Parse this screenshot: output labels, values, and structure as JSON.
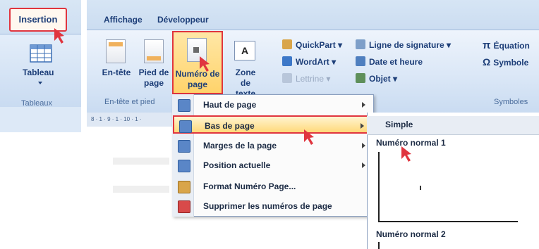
{
  "left_ribbon": {
    "tab_insertion": "Insertion",
    "table_button": "Tableau",
    "group_label": "Tableaux"
  },
  "tabs": {
    "affichage": "Affichage",
    "developpeur": "Développeur"
  },
  "ribbon": {
    "entete": "En-tête",
    "pied_de_page": "Pied de page",
    "numero_de_page": "Numéro de page",
    "zone_de_texte": "Zone de texte",
    "quickpart": "QuickPart",
    "wordart": "WordArt",
    "lettrine": "Lettrine",
    "ligne_signature": "Ligne de signature",
    "date_heure": "Date et heure",
    "objet": "Objet",
    "equation": "Équation",
    "symbole": "Symbole",
    "group_entete": "En-tête et pied",
    "group_symboles": "Symboles"
  },
  "ruler_text": "8 · 1 · 9 · 1 · 10 · 1 ·",
  "menu": {
    "items": [
      {
        "label": "Haut de page"
      },
      {
        "label": "Bas de page"
      },
      {
        "label": "Marges de la page"
      },
      {
        "label": "Position actuelle"
      },
      {
        "label": "Format Numéro Page..."
      },
      {
        "label": "Supprimer les numéros de page"
      }
    ]
  },
  "gallery": {
    "header": "Simple",
    "option1": "Numéro normal 1",
    "option2": "Numéro normal 2"
  },
  "colors": {
    "highlight_border": "#e0353f",
    "ribbon_text": "#1d3e78",
    "hover_fill": "#ffd97a"
  }
}
